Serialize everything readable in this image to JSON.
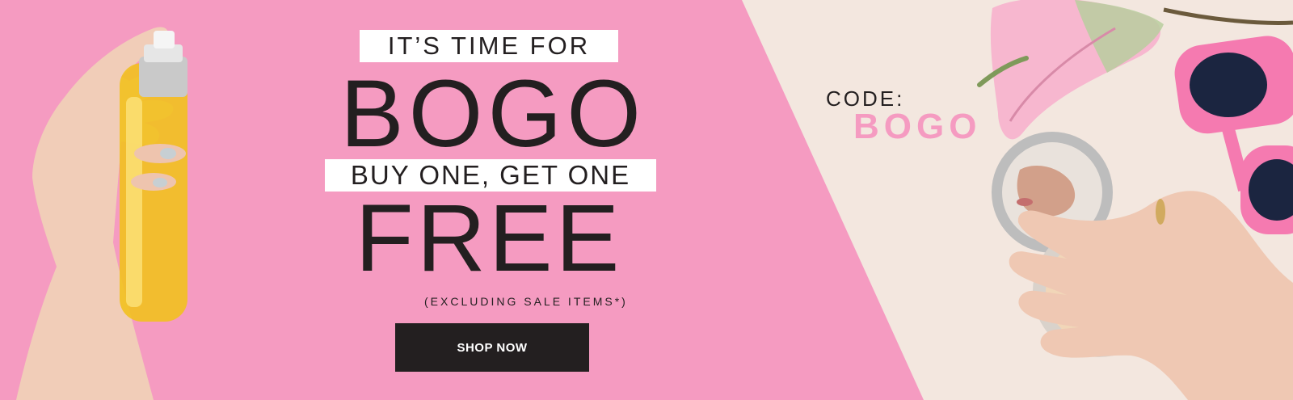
{
  "banner": {
    "line1": "IT’S TIME FOR",
    "line2": "BOGO",
    "line3": "BUY ONE, GET ONE",
    "line4": "FREE",
    "note": "(EXCLUDING SALE ITEMS*)",
    "cta_label": "SHOP NOW",
    "code_label": "CODE:",
    "code_value": "BOGO"
  },
  "colors": {
    "pink": "#f59bc1",
    "cream": "#f3e7df",
    "ink": "#231f20",
    "white": "#ffffff"
  },
  "images": {
    "left": "hand-holding-perfume-bottle",
    "right_top": "anthurium-leaf-and-pink-sunglasses",
    "right_bottom": "hand-holding-compact-powder-mirror"
  }
}
